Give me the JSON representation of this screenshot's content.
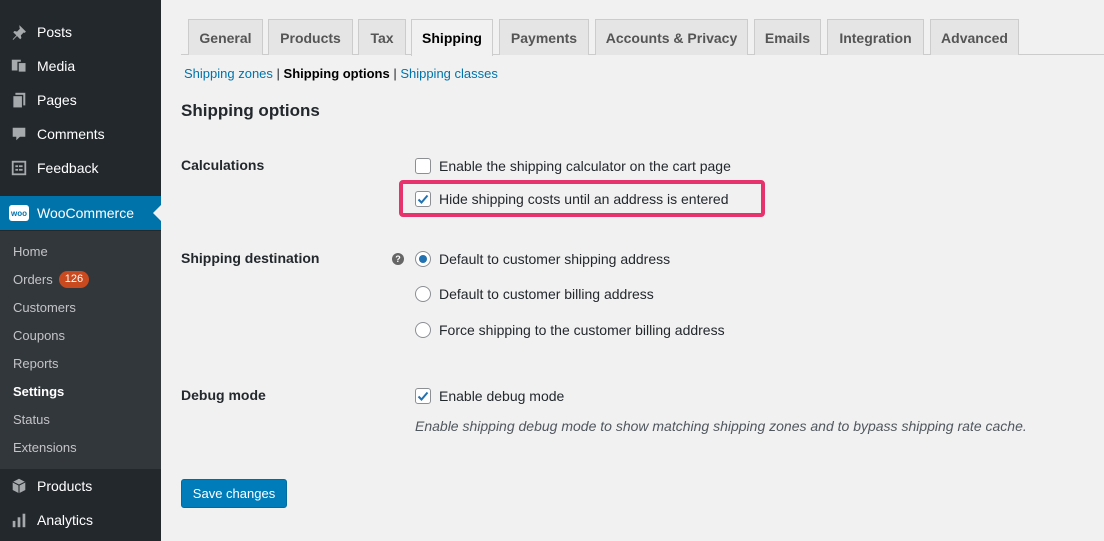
{
  "sidebar": {
    "top_items": [
      {
        "label": "Posts",
        "icon": "pin-icon"
      },
      {
        "label": "Media",
        "icon": "media-icon"
      },
      {
        "label": "Pages",
        "icon": "pages-icon"
      },
      {
        "label": "Comments",
        "icon": "comment-icon"
      },
      {
        "label": "Feedback",
        "icon": "feedback-icon"
      }
    ],
    "woocommerce": {
      "label": "WooCommerce",
      "icon_text": "woo"
    },
    "submenu": [
      {
        "label": "Home"
      },
      {
        "label": "Orders",
        "badge": "126"
      },
      {
        "label": "Customers"
      },
      {
        "label": "Coupons"
      },
      {
        "label": "Reports"
      },
      {
        "label": "Settings"
      },
      {
        "label": "Status"
      },
      {
        "label": "Extensions"
      }
    ],
    "bottom_items": [
      {
        "label": "Products",
        "icon": "box-icon"
      },
      {
        "label": "Analytics",
        "icon": "bar-chart-icon"
      }
    ]
  },
  "tabs": [
    "General",
    "Products",
    "Tax",
    "Shipping",
    "Payments",
    "Accounts & Privacy",
    "Emails",
    "Integration",
    "Advanced"
  ],
  "active_tab": "Shipping",
  "sublinks": {
    "zones": "Shipping zones",
    "options": "Shipping options",
    "classes": "Shipping classes"
  },
  "page": {
    "title": "Shipping options",
    "calculations": {
      "label": "Calculations",
      "opt1": "Enable the shipping calculator on the cart page",
      "opt2": "Hide shipping costs until an address is entered"
    },
    "destination": {
      "label": "Shipping destination",
      "help": "?",
      "opt1": "Default to customer shipping address",
      "opt2": "Default to customer billing address",
      "opt3": "Force shipping to the customer billing address"
    },
    "debug": {
      "label": "Debug mode",
      "opt": "Enable debug mode",
      "desc": "Enable shipping debug mode to show matching shipping zones and to bypass shipping rate cache."
    },
    "save_label": "Save changes"
  },
  "colors": {
    "accent": "#0073aa",
    "highlight": "#e6336d",
    "sidebar": "#23282d"
  }
}
